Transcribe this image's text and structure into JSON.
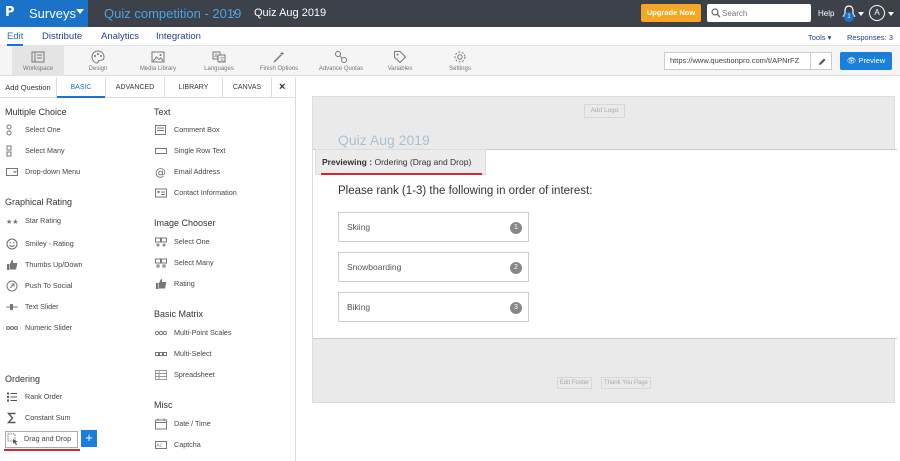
{
  "header": {
    "logo_letter": "P",
    "app_name": "Surveys",
    "breadcrumb_folder": "Quiz competition - 2019",
    "breadcrumb_separator": "›",
    "breadcrumb_survey": "Quiz Aug 2019",
    "upgrade_label": "Upgrade Now",
    "search_placeholder": "Search",
    "help_label": "Help",
    "notification_count": "1",
    "avatar_initial": "A"
  },
  "menu": {
    "items": [
      "Edit",
      "Distribute",
      "Analytics",
      "Integration"
    ],
    "active": "Edit",
    "tools_label": "Tools ▾",
    "responses_label": "Responses: 3"
  },
  "toolbar": {
    "tools": [
      {
        "label": "Workspace",
        "icon": "workspace-icon"
      },
      {
        "label": "Design",
        "icon": "palette-icon"
      },
      {
        "label": "Media Library",
        "icon": "image-icon"
      },
      {
        "label": "Languages",
        "icon": "language-icon"
      },
      {
        "label": "Finish Options",
        "icon": "wand-icon"
      },
      {
        "label": "Advance Quotas",
        "icon": "quota-icon"
      },
      {
        "label": "Variables",
        "icon": "tag-icon"
      },
      {
        "label": "Settings",
        "icon": "gear-icon"
      }
    ],
    "survey_url": "https://www.questionpro.com/t/APNrFZ",
    "preview_label": "Preview"
  },
  "left_panel": {
    "add_question_label": "Add Question",
    "tabs": [
      "BASIC",
      "ADVANCED",
      "LIBRARY",
      "CANVAS"
    ],
    "active_tab": "BASIC",
    "close_label": "×",
    "col1": {
      "multiple_choice": {
        "title": "Multiple Choice",
        "items": [
          "Select One",
          "Select Many",
          "Drop-down Menu"
        ]
      },
      "graphical_rating": {
        "title": "Graphical Rating",
        "items": [
          "Star Rating",
          "Smiley - Rating",
          "Thumbs Up/Down",
          "Push To Social",
          "Text Slider",
          "Numeric Slider"
        ]
      },
      "ordering": {
        "title": "Ordering",
        "items": [
          "Rank Order",
          "Constant Sum",
          "Drag and Drop"
        ]
      }
    },
    "col2": {
      "text": {
        "title": "Text",
        "items": [
          "Comment Box",
          "Single Row Text",
          "Email Address",
          "Contact Information"
        ]
      },
      "image_chooser": {
        "title": "Image Chooser",
        "items": [
          "Select One",
          "Select Many",
          "Rating"
        ]
      },
      "basic_matrix": {
        "title": "Basic Matrix",
        "items": [
          "Multi-Point Scales",
          "Multi-Select",
          "Spreadsheet"
        ]
      },
      "misc": {
        "title": "Misc",
        "items": [
          "Date / Time",
          "Captcha"
        ]
      }
    },
    "add_button_label": "+"
  },
  "canvas": {
    "add_logo_label": "Add Logo",
    "survey_title": "Quiz Aug 2019",
    "previewing_prefix": "Previewing :",
    "previewing_type": "Ordering (Drag and Drop)",
    "question": "Please rank (1-3) the following in order of interest:",
    "options": [
      {
        "label": "Skiing",
        "rank": "1"
      },
      {
        "label": "Snowboarding",
        "rank": "2"
      },
      {
        "label": "Biking",
        "rank": "3"
      }
    ],
    "footer_buttons": [
      "Edit Footer",
      "Thank You Page"
    ]
  },
  "colors": {
    "topbar": "#3d4149",
    "brand_blue": "#1a73c9",
    "upgrade_orange": "#f5a623",
    "highlight_red": "#d7262b"
  }
}
